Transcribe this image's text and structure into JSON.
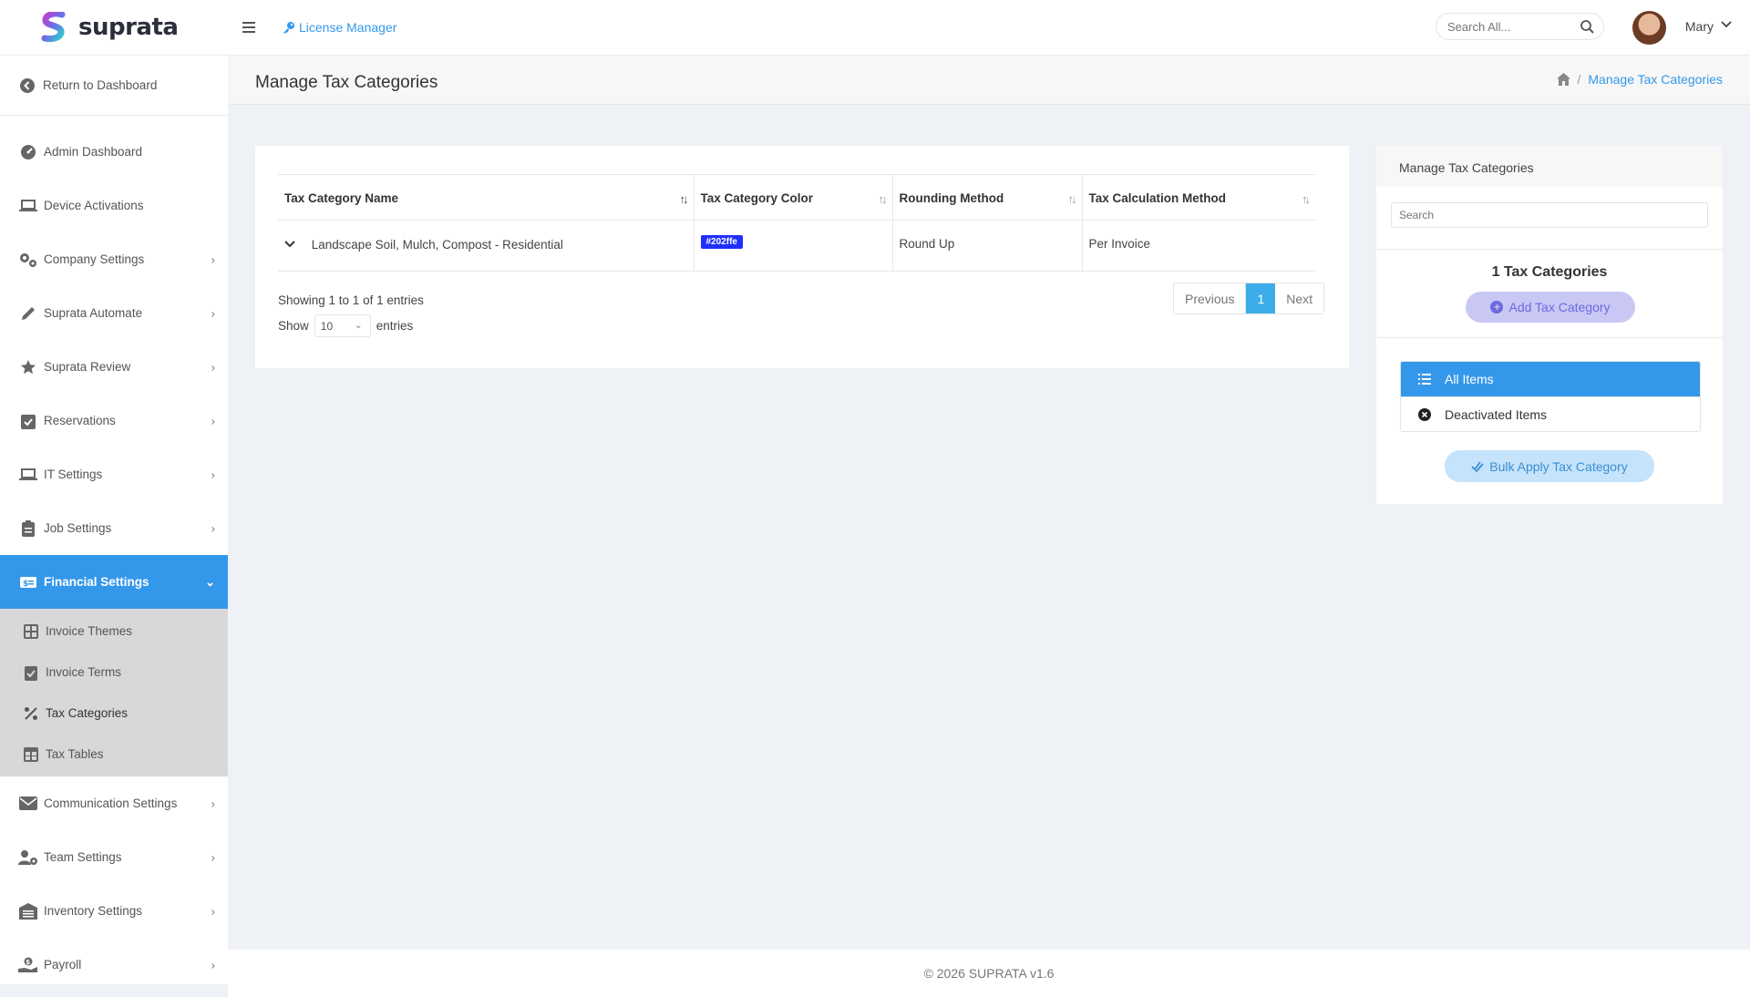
{
  "brand": {
    "name": "suprata"
  },
  "sidebar": {
    "return_label": "Return to Dashboard",
    "items": [
      {
        "label": "Admin Dashboard",
        "icon": "gauge-icon",
        "chevron": false
      },
      {
        "label": "Device Activations",
        "icon": "laptop-icon",
        "chevron": false
      },
      {
        "label": "Company Settings",
        "icon": "gears-icon",
        "chevron": true
      },
      {
        "label": "Suprata Automate",
        "icon": "pen-icon",
        "chevron": true
      },
      {
        "label": "Suprata Review",
        "icon": "star-icon",
        "chevron": true
      },
      {
        "label": "Reservations",
        "icon": "calendar-check-icon",
        "chevron": true
      },
      {
        "label": "IT Settings",
        "icon": "laptop-icon",
        "chevron": true
      },
      {
        "label": "Job Settings",
        "icon": "clipboard-icon",
        "chevron": true
      },
      {
        "label": "Financial Settings",
        "icon": "money-card-icon",
        "chevron": true,
        "active": true
      }
    ],
    "subitems": [
      {
        "label": "Invoice Themes",
        "icon": "grid-icon"
      },
      {
        "label": "Invoice Terms",
        "icon": "clipboard-check-icon"
      },
      {
        "label": "Tax Categories",
        "icon": "percent-icon",
        "current": true
      },
      {
        "label": "Tax Tables",
        "icon": "table-icon"
      }
    ],
    "items_after": [
      {
        "label": "Communication Settings",
        "icon": "envelope-icon",
        "chevron": true
      },
      {
        "label": "Team Settings",
        "icon": "user-gear-icon",
        "chevron": true
      },
      {
        "label": "Inventory Settings",
        "icon": "warehouse-icon",
        "chevron": true
      },
      {
        "label": "Payroll",
        "icon": "hand-coin-icon",
        "chevron": true
      }
    ]
  },
  "topbar": {
    "link_label": "License Manager",
    "search_placeholder": "Search All...",
    "user_name": "Mary"
  },
  "page": {
    "title": "Manage Tax Categories",
    "breadcrumb_current": "Manage Tax Categories"
  },
  "table": {
    "columns": [
      "Tax Category Name",
      "Tax Category Color",
      "Rounding Method",
      "Tax Calculation Method"
    ],
    "rows": [
      {
        "name": "Landscape Soil, Mulch, Compost - Residential",
        "color": "#202ffe",
        "rounding": "Round Up",
        "calculation": "Per Invoice"
      }
    ],
    "info": "Showing 1 to 1 of 1 entries",
    "show_label": "Show",
    "show_value": "10",
    "entries_label": "entries",
    "pager": {
      "prev": "Previous",
      "current": "1",
      "next": "Next"
    }
  },
  "side": {
    "title": "Manage Tax Categories",
    "search_placeholder": "Search",
    "count_label": "1 Tax Categories",
    "add_label": "Add Tax Category",
    "filters": [
      "All Items",
      "Deactivated Items"
    ],
    "bulk_label": "Bulk Apply Tax Category"
  },
  "footer": {
    "text": "© 2026 SUPRATA v1.6"
  },
  "colors": {
    "accent": "#3498ea",
    "swatch": "#202ffe"
  }
}
